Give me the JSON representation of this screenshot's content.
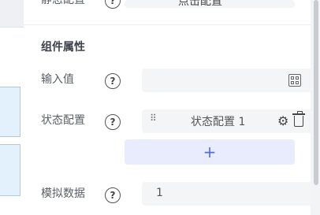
{
  "top_row": {
    "label": "静态配置",
    "field_value": "点击配置"
  },
  "section": {
    "title": "组件属性"
  },
  "input_value": {
    "label": "输入值",
    "value": ""
  },
  "state_config": {
    "label": "状态配置",
    "item_label": "状态配置 1",
    "add_label": "+"
  },
  "mock_data": {
    "label": "模拟数据",
    "value": "1"
  },
  "help_glyph": "?",
  "icons": {
    "help": "question-circle-icon",
    "field": "grid-icon",
    "drag": "drag-handle-icon",
    "settings": "gear-icon",
    "delete": "trash-icon"
  },
  "colors": {
    "accent": "#4f6af0",
    "add_bg": "#e8ecfc",
    "field_bg": "#f4f5f7",
    "canvas_block": "#e3f1fc"
  }
}
